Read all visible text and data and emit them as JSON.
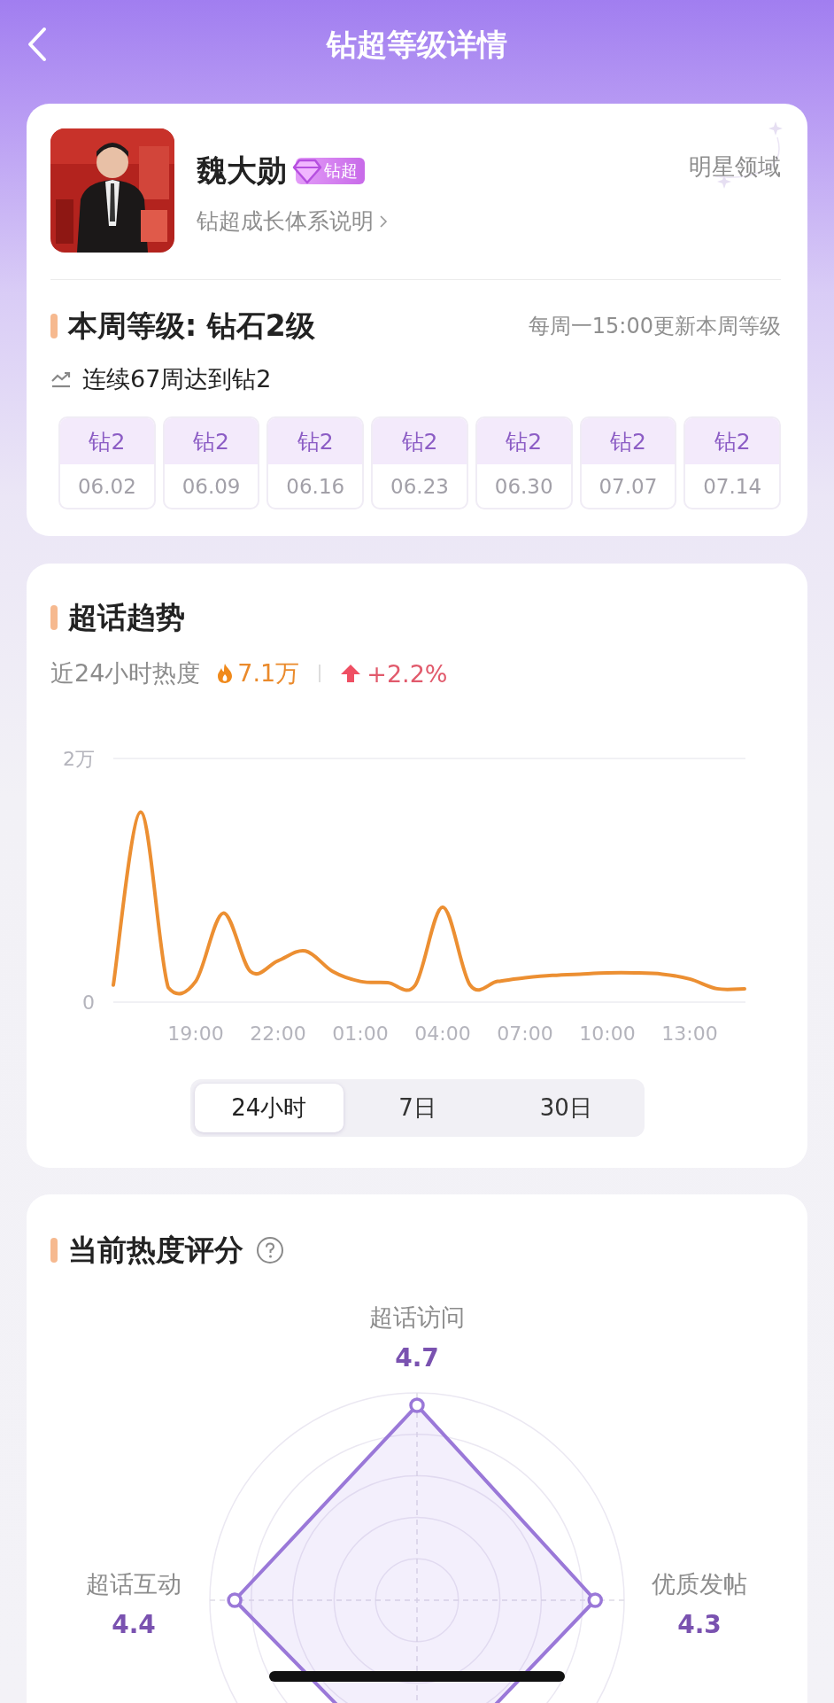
{
  "header": {
    "title": "钻超等级详情"
  },
  "profile": {
    "name": "魏大勋",
    "badge": "钻超",
    "link": "钻超成长体系说明",
    "domain": "明星领域"
  },
  "level": {
    "title": "本周等级: 钻石2级",
    "note": "每周一15:00更新本周等级",
    "streak": "连续67周达到钻2",
    "weeks": [
      {
        "level": "钻2",
        "date": "06.02"
      },
      {
        "level": "钻2",
        "date": "06.09"
      },
      {
        "level": "钻2",
        "date": "06.16"
      },
      {
        "level": "钻2",
        "date": "06.23"
      },
      {
        "level": "钻2",
        "date": "06.30"
      },
      {
        "level": "钻2",
        "date": "07.07"
      },
      {
        "level": "钻2",
        "date": "07.14"
      }
    ]
  },
  "trend": {
    "title": "超话趋势",
    "heat_label": "近24小时热度",
    "heat_value": "7.1万",
    "change": "+2.2%",
    "chart_data": {
      "type": "line",
      "categories": [
        null,
        null,
        null,
        "19:00",
        null,
        null,
        "22:00",
        null,
        null,
        "01:00",
        null,
        null,
        "04:00",
        null,
        null,
        "07:00",
        null,
        null,
        "10:00",
        null,
        null,
        "13:00",
        null,
        null
      ],
      "series": [
        {
          "color": "#ec8f32",
          "values": [
            0.14,
            1.56,
            0.12,
            0.17,
            0.73,
            0.25,
            0.34,
            0.42,
            0.25,
            0.17,
            0.16,
            0.14,
            0.78,
            0.14,
            0.17,
            0.2,
            0.22,
            0.23,
            0.24,
            0.24,
            0.23,
            0.19,
            0.11,
            0.11
          ]
        }
      ],
      "ylim": [
        0,
        2
      ],
      "yticks": [
        {
          "value": 0,
          "label": "0"
        },
        {
          "value": 2,
          "label": "2万"
        }
      ]
    },
    "tabs": [
      {
        "label": "24小时",
        "selected": true
      },
      {
        "label": "7日",
        "selected": false
      },
      {
        "label": "30日",
        "selected": false
      }
    ]
  },
  "score": {
    "title": "当前热度评分",
    "items": [
      {
        "label": "超话访问",
        "value": "4.7"
      },
      {
        "label": "超话互动",
        "value": "4.4"
      },
      {
        "label": "优质发帖",
        "value": "4.3"
      }
    ]
  }
}
